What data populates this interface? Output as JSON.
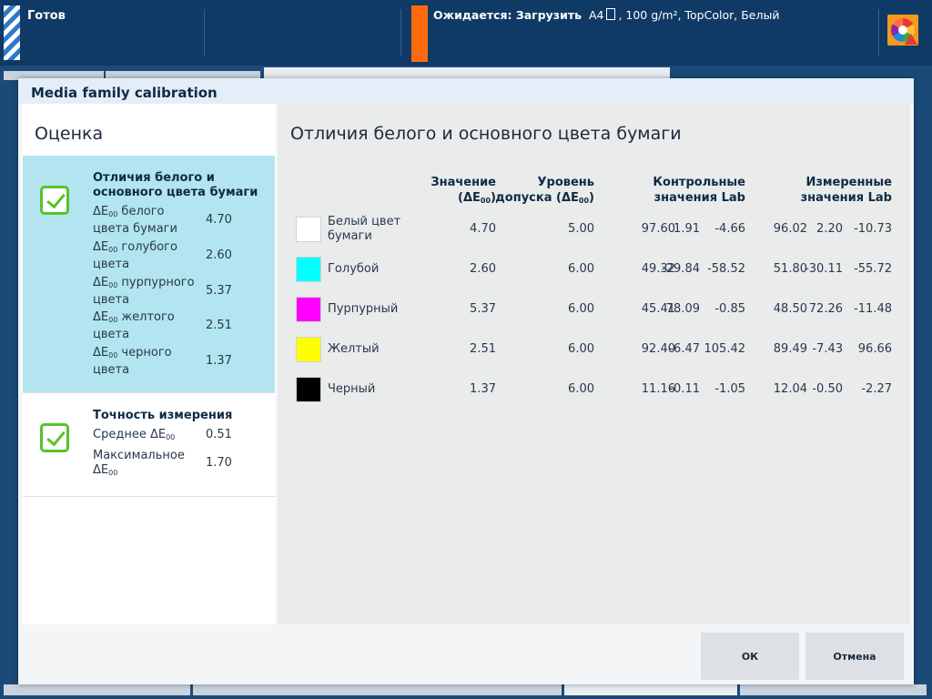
{
  "topbar": {
    "status": "Готов",
    "job_label": "Ожидается: Загрузить",
    "job_paper_size": "A4",
    "job_details": ", 100 g/m², TopColor, Белый"
  },
  "dialog": {
    "title": "Media family calibration",
    "left": {
      "title": "Оценка",
      "cards": [
        {
          "title": "Отличия белого и основного цвета бумаги",
          "metrics": [
            {
              "prefix": "ΔE",
              "sub": "00",
              "suffix": " белого цвета бумаги",
              "value": "4.70"
            },
            {
              "prefix": "ΔE",
              "sub": "00",
              "suffix": " голубого цвета",
              "value": "2.60"
            },
            {
              "prefix": "ΔE",
              "sub": "00",
              "suffix": " пурпурного цвета",
              "value": "5.37"
            },
            {
              "prefix": "ΔE",
              "sub": "00",
              "suffix": " желтого цвета",
              "value": "2.51"
            },
            {
              "prefix": "ΔE",
              "sub": "00",
              "suffix": " черного цвета",
              "value": "1.37"
            }
          ]
        },
        {
          "title": "Точность измерения",
          "metrics": [
            {
              "prefix": "Среднее ΔE",
              "sub": "00",
              "suffix": "",
              "value": "0.51"
            },
            {
              "prefix": "Максимальное ΔE",
              "sub": "00",
              "suffix": "",
              "value": "1.70"
            }
          ]
        }
      ]
    },
    "right": {
      "title": "Отличия белого и основного цвета бумаги",
      "headers": {
        "value_line1": "Значение",
        "value_line2_prefix": "(ΔE",
        "value_line2_sub": "00",
        "value_line2_suffix": ")",
        "tolerance_line1": "Уровень",
        "tolerance_line2_prefix": "допуска (ΔE",
        "tolerance_line2_sub": "00",
        "tolerance_line2_suffix": ")",
        "reference_line1": "Контрольные",
        "reference_line2": "значения Lab",
        "measured_line1": "Измеренные",
        "measured_line2": "значения Lab"
      },
      "rows": [
        {
          "name": "Белый цвет бумаги",
          "color": "#ffffff",
          "value": "4.70",
          "tolerance": "5.00",
          "ref": [
            "97.60",
            "1.91",
            "-4.66"
          ],
          "meas": [
            "96.02",
            "2.20",
            "-10.73"
          ]
        },
        {
          "name": "Голубой",
          "color": "#00ffff",
          "value": "2.60",
          "tolerance": "6.00",
          "ref": [
            "49.32",
            "-29.84",
            "-58.52"
          ],
          "meas": [
            "51.80",
            "-30.11",
            "-55.72"
          ]
        },
        {
          "name": "Пурпурный",
          "color": "#ff00ff",
          "value": "5.37",
          "tolerance": "6.00",
          "ref": [
            "45.41",
            "78.09",
            "-0.85"
          ],
          "meas": [
            "48.50",
            "72.26",
            "-11.48"
          ]
        },
        {
          "name": "Желтый",
          "color": "#ffff00",
          "value": "2.51",
          "tolerance": "6.00",
          "ref": [
            "92.40",
            "-6.47",
            "105.42"
          ],
          "meas": [
            "89.49",
            "-7.43",
            "96.66"
          ]
        },
        {
          "name": "Черный",
          "color": "#000000",
          "value": "1.37",
          "tolerance": "6.00",
          "ref": [
            "11.16",
            "-0.11",
            "-1.05"
          ],
          "meas": [
            "12.04",
            "-0.50",
            "-2.27"
          ]
        }
      ]
    },
    "buttons": {
      "ok": "ОК",
      "cancel": "Отмена"
    }
  }
}
